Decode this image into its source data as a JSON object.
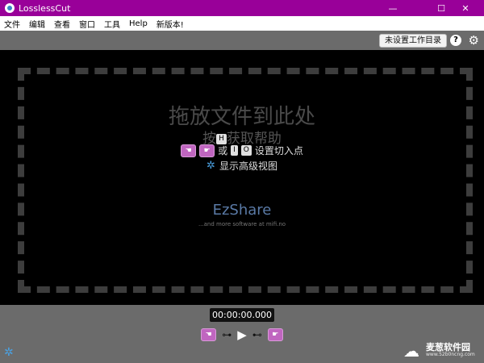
{
  "window": {
    "title": "LosslessCut",
    "controls": {
      "minimize": "—",
      "maximize": "☐",
      "close": "✕"
    }
  },
  "menu": [
    "文件",
    "编辑",
    "查看",
    "窗口",
    "工具",
    "Help",
    "新版本!"
  ],
  "topbar": {
    "working_dir_button": "未设置工作目录",
    "help_button": "?",
    "settings_icon": "gear-icon"
  },
  "drop": {
    "title": "拖放文件到此处",
    "help_prefix": "按",
    "help_key": "H",
    "help_suffix": "获取帮助",
    "cut_or": "或",
    "cut_key_start": "I",
    "cut_key_end": "O",
    "cut_suffix": "设置切入点",
    "simple_mode": "显示高级视图"
  },
  "branding": {
    "name": "EzShare",
    "subtitle": "...and more software at mifi.no"
  },
  "bottom": {
    "timecode": "00:00:00.000"
  },
  "watermark": {
    "text": "麦葱软件园",
    "url": "www.52b0ncng.com"
  },
  "colors": {
    "titlebar": "#990099",
    "accent_pink": "#c066c0",
    "panel_gray": "#6b6b6b"
  }
}
